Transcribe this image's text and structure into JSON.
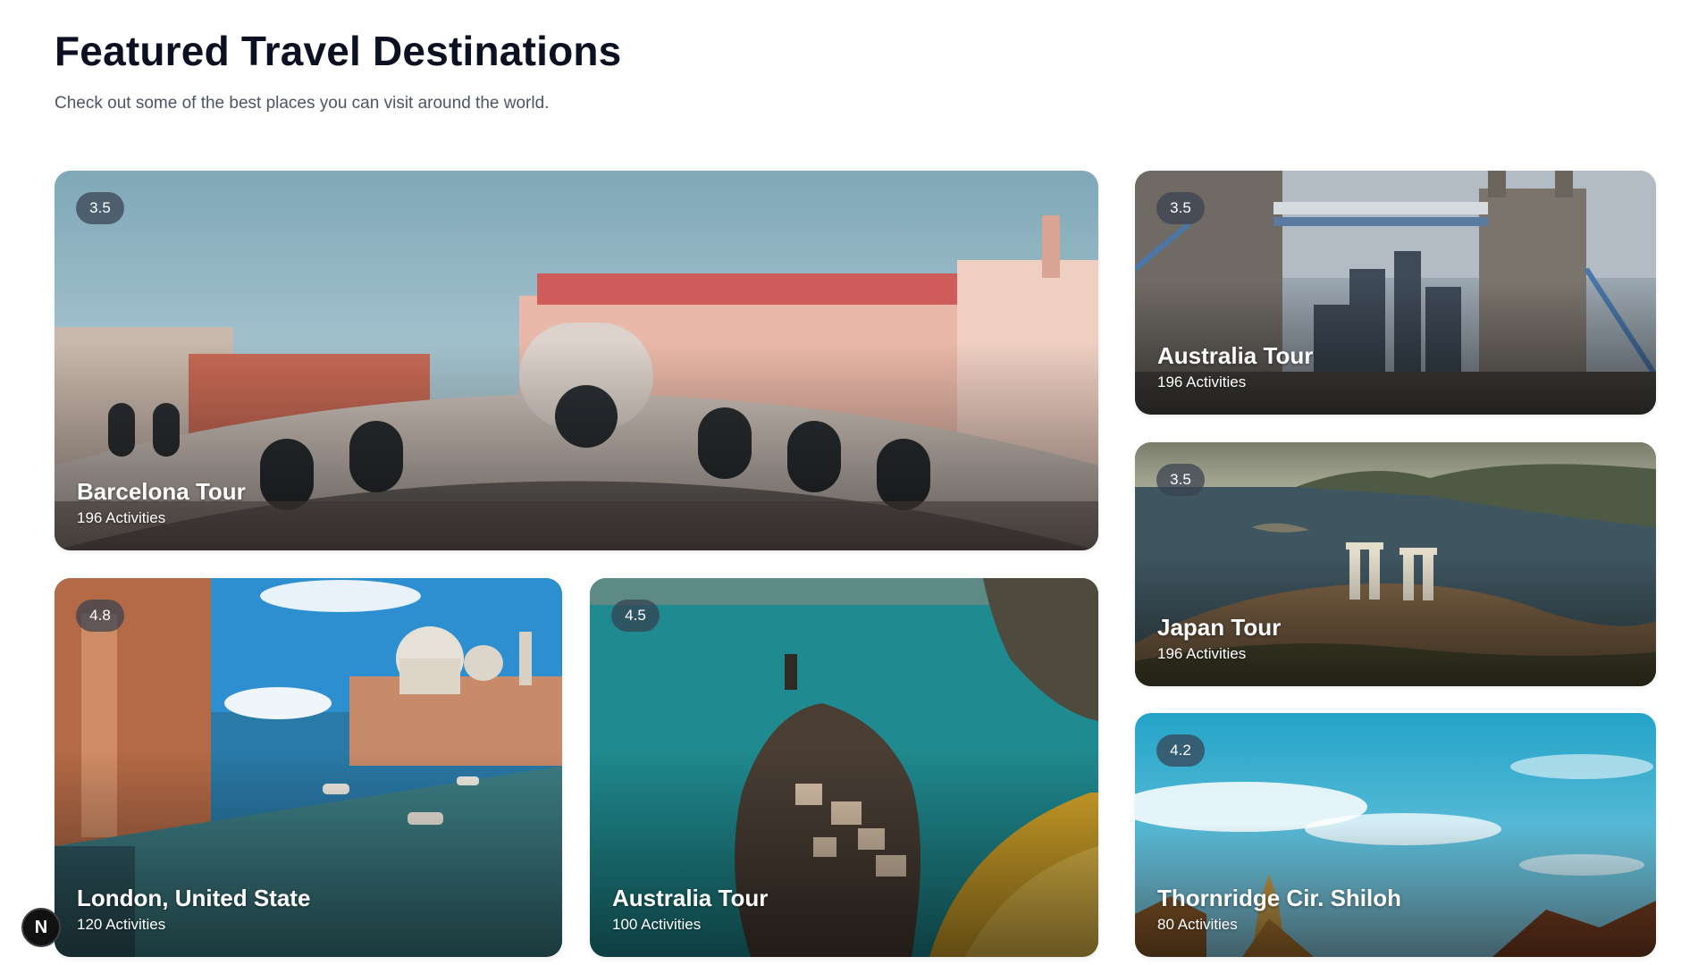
{
  "header": {
    "title": "Featured Travel Destinations",
    "subtitle": "Check out some of the best places you can visit around the world."
  },
  "destinations": [
    {
      "rating": "3.5",
      "title": "Barcelona Tour",
      "activities": "196 Activities",
      "scene": "venice-bridge-photo"
    },
    {
      "rating": "3.5",
      "title": "Australia Tour",
      "activities": "196 Activities",
      "scene": "tower-bridge-photo"
    },
    {
      "rating": "3.5",
      "title": "Japan Tour",
      "activities": "196 Activities",
      "scene": "coastal-temple-ruins-photo"
    },
    {
      "rating": "4.8",
      "title": "London, United State",
      "activities": "120 Activities",
      "scene": "venice-grand-canal-photo"
    },
    {
      "rating": "4.5",
      "title": "Australia Tour",
      "activities": "100 Activities",
      "scene": "cliffside-village-photo"
    },
    {
      "rating": "4.2",
      "title": "Thornridge Cir. Shiloh",
      "activities": "80 Activities",
      "scene": "sky-temple-roofs-photo"
    }
  ],
  "dev_badge": {
    "label": "N",
    "icon": "nextjs-dev-icon"
  }
}
